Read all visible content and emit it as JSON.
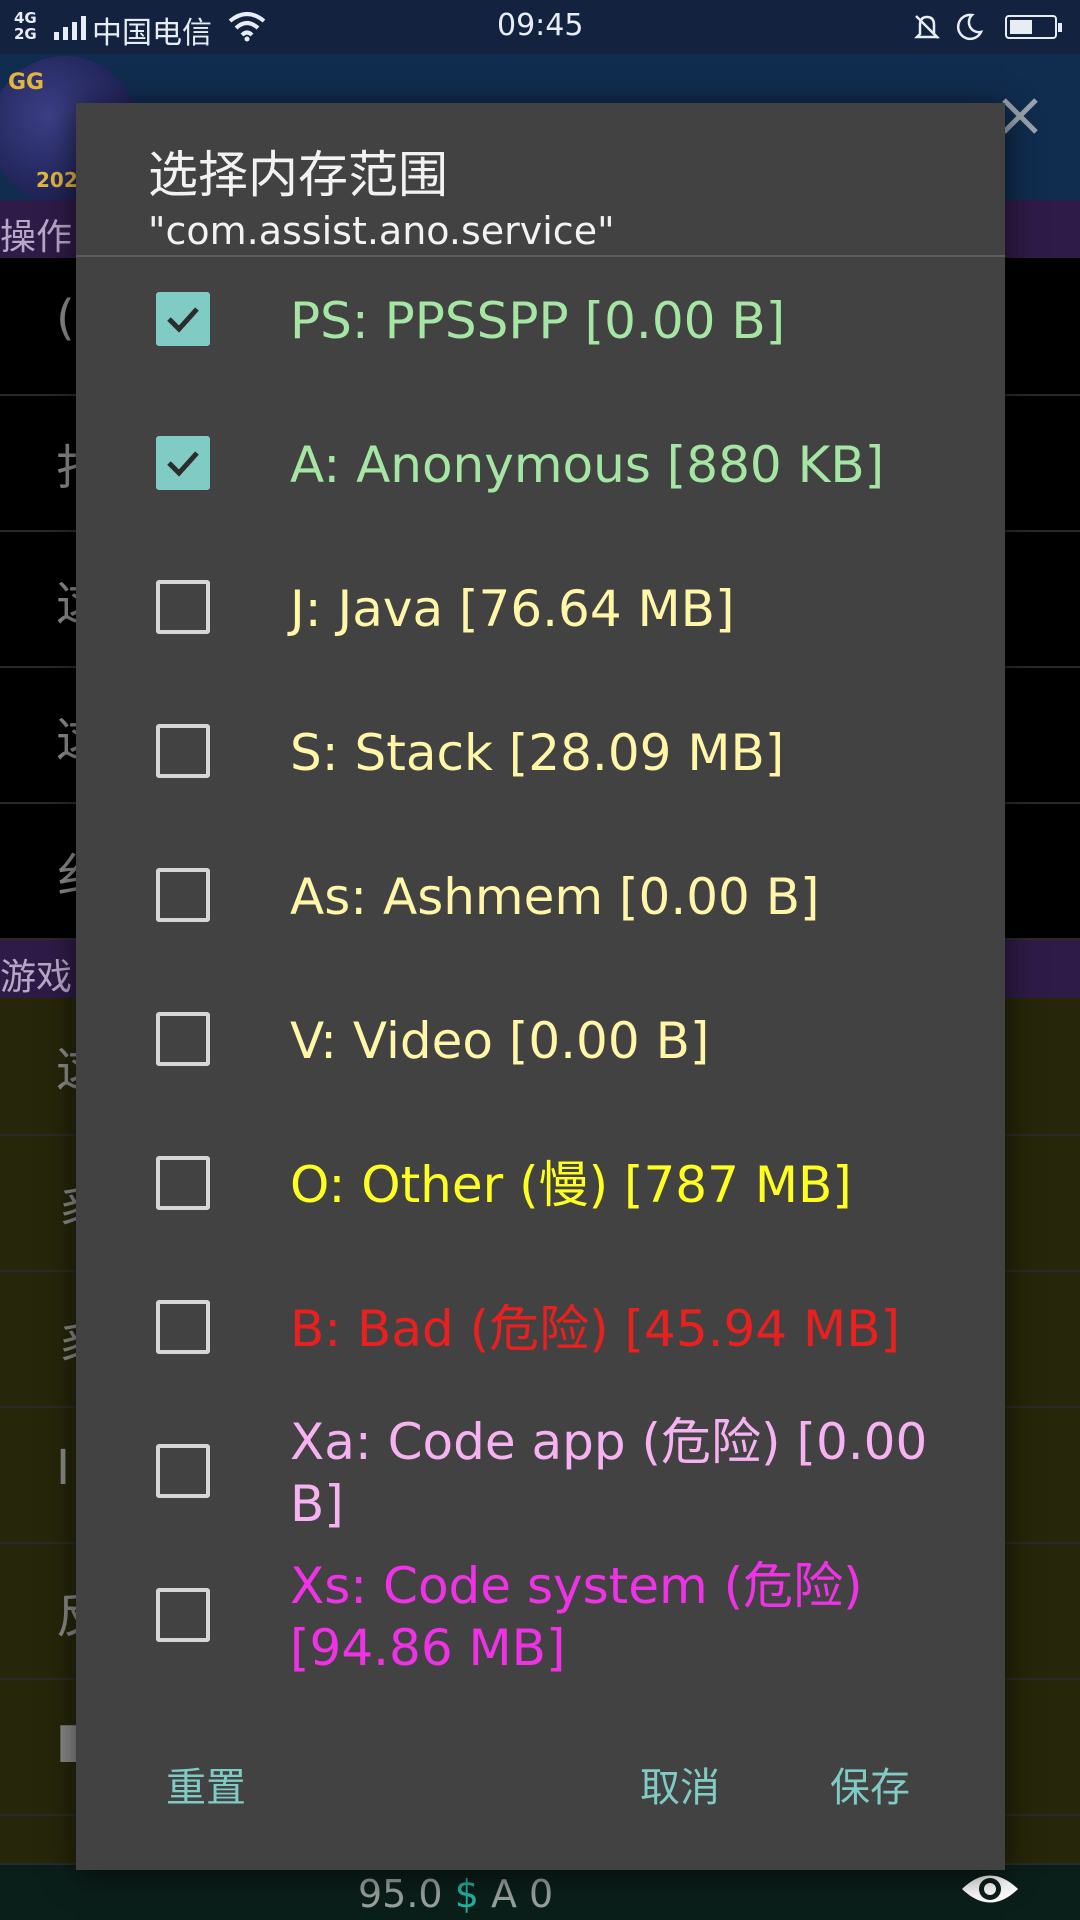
{
  "status_bar": {
    "network": "4G/2G",
    "carrier": "中国电信",
    "time": "09:45",
    "icons": [
      "signal-icon",
      "wifi-icon",
      "bell-muted-icon",
      "moon-icon",
      "battery-icon"
    ]
  },
  "background": {
    "logo_text": "GG",
    "logo_year": "202",
    "section1": "操作",
    "section2": "游戏",
    "row_glyphs": [
      "(",
      "打",
      "这",
      "这",
      "纟",
      "这",
      "豸",
      "豸",
      "I",
      "反",
      "■"
    ],
    "bottom_stats": {
      "left": "95.0",
      "currency": "$",
      "right": "A 0"
    }
  },
  "dialog": {
    "title": "选择内存范围",
    "subtitle": "\"com.assist.ano.service\"",
    "options": [
      {
        "label": "PS: PPSSPP [0.00 B]",
        "checked": true,
        "color": "#a5e6a4"
      },
      {
        "label": "A: Anonymous [880 KB]",
        "checked": true,
        "color": "#a5e6a4"
      },
      {
        "label": "J: Java [76.64 MB]",
        "checked": false,
        "color": "#fff6a8"
      },
      {
        "label": "S: Stack [28.09 MB]",
        "checked": false,
        "color": "#fff6a8"
      },
      {
        "label": "As: Ashmem [0.00 B]",
        "checked": false,
        "color": "#fff6a8"
      },
      {
        "label": "V: Video [0.00 B]",
        "checked": false,
        "color": "#fff6a8"
      },
      {
        "label": "O: Other (慢) [787 MB]",
        "checked": false,
        "color": "#ffff22"
      },
      {
        "label": "B: Bad (危险) [45.94 MB]",
        "checked": false,
        "color": "#e8201f"
      },
      {
        "label": "Xa: Code app (危险) [0.00 B]",
        "checked": false,
        "color": "#f7b2f2"
      },
      {
        "label": "Xs: Code system (危险) [94.86 MB]",
        "checked": false,
        "color": "#f032e6"
      }
    ],
    "buttons": {
      "reset": "重置",
      "cancel": "取消",
      "save": "保存"
    },
    "button_color": "#80cbc4"
  }
}
